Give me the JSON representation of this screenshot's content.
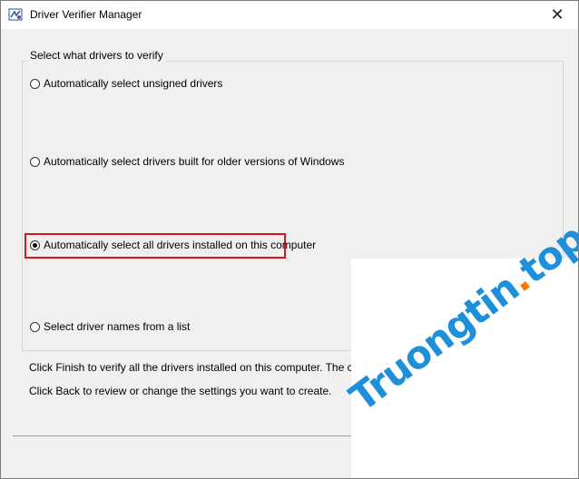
{
  "window": {
    "title": "Driver Verifier Manager",
    "close_glyph": "✕"
  },
  "group": {
    "legend": "Select what drivers to verify",
    "options": [
      {
        "label": "Automatically select unsigned drivers",
        "checked": false
      },
      {
        "label": "Automatically select drivers built for older versions of Windows",
        "checked": false
      },
      {
        "label": "Automatically select all drivers installed on this computer",
        "checked": true
      },
      {
        "label": "Select driver names from a list",
        "checked": false
      }
    ]
  },
  "info": {
    "line1": "Click Finish to verify all the drivers installed on this computer. The current se",
    "line2": "Click Back to review or change the settings you want to create."
  },
  "watermark": {
    "text_main": "Truongtin",
    "text_dot": ".",
    "text_tld": "top"
  },
  "colors": {
    "highlight": "#e1141e",
    "watermark_blue": "#1e8fd8",
    "watermark_orange": "#f57a0a"
  }
}
